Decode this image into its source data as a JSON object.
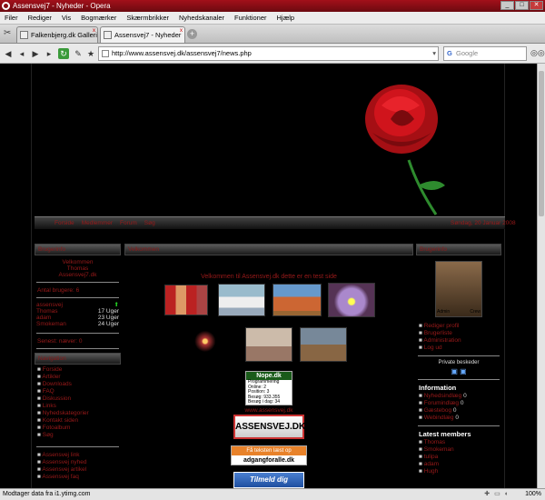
{
  "window": {
    "title": "Assensvej7 - Nyheder - Opera"
  },
  "menu": [
    "Filer",
    "Rediger",
    "Vis",
    "Bogmærker",
    "Skærmbrikker",
    "Nyhedskanaler",
    "Funktioner",
    "Hjælp"
  ],
  "tabs": [
    {
      "label": "Falkenbjerg.dk Galleri..."
    },
    {
      "label": "Assensvej7 - Nyheder"
    }
  ],
  "address": {
    "url": "http://www.assensvej.dk/assensvej7/news.php",
    "search_placeholder": "Google"
  },
  "site": {
    "nav_items": [
      "Forside",
      "Medlemmer",
      "Forum",
      "Søg"
    ],
    "nav_right": "Søndag, 20 Januar 2008",
    "left": {
      "head": "Brugerinfo",
      "welcome": [
        "Velkommen",
        "Thomas",
        "Assensvej7.dk"
      ],
      "members_label": "Antal brugere: 6",
      "users": [
        {
          "name": "assensvej",
          "val": ""
        },
        {
          "name": "Thomas",
          "val": "17 Uger"
        },
        {
          "name": "adam",
          "val": "23 Uger"
        },
        {
          "name": "Smokeman",
          "val": "24 Uger"
        }
      ],
      "newest": "Senest: næver: 0",
      "nav_head": "Navigation",
      "nav": [
        "Forside",
        "Artikler",
        "Downloads",
        "FAQ",
        "Diskussion",
        "Links",
        "Nyhedskategorier",
        "Kontakt siden",
        "Fotoalbum",
        "Søg"
      ],
      "links": [
        "Assensvej link",
        "Assensvej nyhed",
        "Assensvej artikel",
        "Assensvej faq"
      ]
    },
    "center": {
      "head": "Velkommen",
      "welcome_text": "Velkommen til Assensvej.dk dette er en test side",
      "nope": {
        "title": "Nope.dk",
        "lines": [
          "Programmering",
          "Online:  2",
          "Position:  3",
          "Besøg:  933.355",
          "Besøg i dag:  34"
        ]
      },
      "site_link": "www.assensvej.dk",
      "banner1": "ASSENSVEJ.DK",
      "banner2_top": "Få teksten læst op",
      "banner2_bottom": "adgangforalle.dk",
      "banner3": "Tilmeld dig"
    },
    "right": {
      "head": "Brugerinfo",
      "avatar_text_left": "Admin",
      "avatar_text_right": "Crew",
      "links": [
        "Rediger profil",
        "Brugerliste",
        "Administration",
        "Log ud"
      ],
      "pm_head": "Private beskeder",
      "info_head": "Information",
      "info": [
        {
          "label": "Nyhedsindlæg",
          "val": "0"
        },
        {
          "label": "Forumindlæg",
          "val": "0"
        },
        {
          "label": "Gæstebog",
          "val": "0"
        },
        {
          "label": "Webindlæg",
          "val": "0"
        }
      ],
      "latest_head": "Latest members",
      "latest": [
        "Thomas",
        "Smokeman",
        "tulipa",
        "adam",
        "Hugh"
      ]
    }
  },
  "status": {
    "text": "Modtager data fra i1.ytimg.com",
    "zoom": "100%"
  }
}
